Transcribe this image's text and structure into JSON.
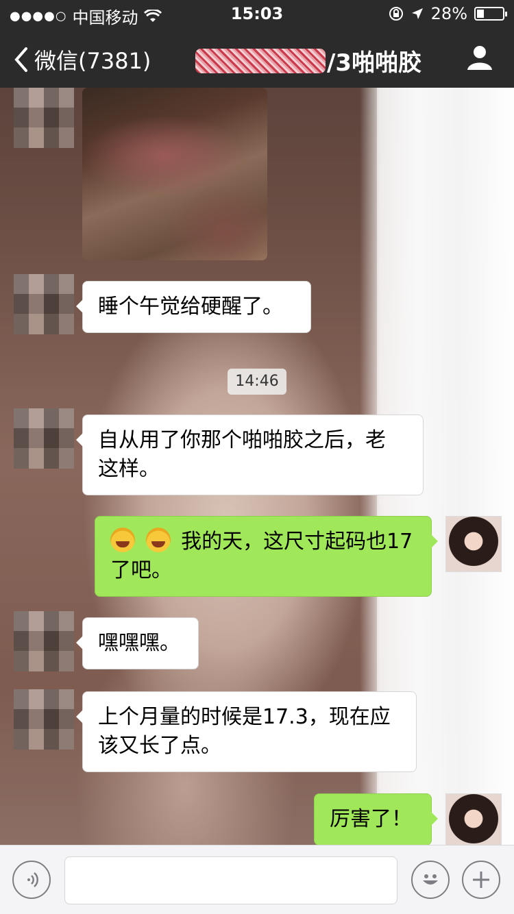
{
  "status_bar": {
    "signal": "●●●●○",
    "carrier": "中国移动",
    "time": "15:03",
    "battery": "28%",
    "battery_level": 0.28
  },
  "nav": {
    "back_label": "微信(7381)",
    "title_suffix": "/3啪啪胶"
  },
  "messages": {
    "m1": "睡个午觉给硬醒了。",
    "timestamp": "14:46",
    "m2_line1": "自从用了你那个啪啪胶之后，老",
    "m2_line2": "这样。",
    "m3_line1": "我的天，这尺寸起码也17",
    "m3_line2": "了吧。",
    "m4": "嘿嘿嘿。",
    "m5_line1": "上个月量的时候是17.3，现在应",
    "m5_line2": "该又长了点。",
    "m6": "厉害了！"
  },
  "icons": {
    "back": "chevron-left-icon",
    "person": "person-icon",
    "voice": "voice-icon",
    "emoji": "emoji-icon",
    "add": "plus-icon"
  },
  "colors": {
    "nav_bg": "#2b2b2b",
    "sent_bubble": "#a0e75a",
    "received_bubble": "#ffffff"
  }
}
